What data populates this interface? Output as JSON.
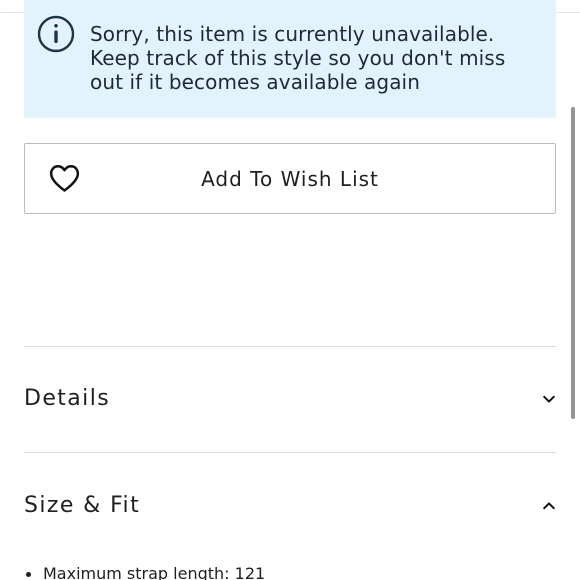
{
  "notice": {
    "message": "Sorry, this item is currently unavailable. Keep track of this style so you don't miss out if it becomes available again",
    "icon": "info-icon"
  },
  "wishlist": {
    "label": "Add To Wish List",
    "icon": "heart-outline-icon"
  },
  "sections": {
    "details": {
      "title": "Details",
      "state": "collapsed",
      "icon": "chevron-down-icon"
    },
    "size_fit": {
      "title": "Size & Fit",
      "state": "expanded",
      "icon": "chevron-up-icon",
      "items": [
        "Maximum strap length: 121"
      ]
    }
  },
  "colors": {
    "notice_bg": "#e2f3fc",
    "text": "#1f1f1f",
    "divider": "#d7dade"
  }
}
